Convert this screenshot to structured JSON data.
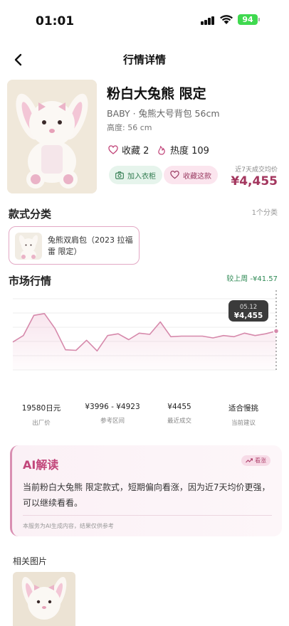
{
  "status": {
    "time": "01:01",
    "battery": "94",
    "icons": [
      "signal-icon",
      "wifi-icon",
      "battery-icon"
    ]
  },
  "nav": {
    "title": "行情详情",
    "back_icon": "chevron-left-icon"
  },
  "product": {
    "name": "粉白大兔熊 限定",
    "subtitle": "BABY · 兔熊大号背包 56cm",
    "height": "高度: 56 cm",
    "favorites": "收藏 2",
    "heat": "热度 109",
    "add_wardrobe": "加入衣柜",
    "collect": "收藏这款",
    "avg_label": "近7天成交均价",
    "avg_price": "¥4,455"
  },
  "category": {
    "title": "款式分类",
    "count": "1个分类",
    "item": "兔熊双肩包（2023 拉福雷 限定）"
  },
  "market": {
    "title": "市场行情",
    "compare": "较上周 -¥41.57",
    "tooltip_date": "05.12",
    "tooltip_price": "¥4,455"
  },
  "reference": [
    {
      "value": "19580日元",
      "label": "出厂价"
    },
    {
      "value": "¥3996 - ¥4923",
      "label": "参考区间"
    },
    {
      "value": "¥4455",
      "label": "最近成交"
    },
    {
      "value": "适合慢挑",
      "label": "当前建议"
    }
  ],
  "ai": {
    "title": "AI解读",
    "tag": "看涨",
    "text": "当前粉白大兔熊 限定款式，短期偏向看涨，因为近7天均价更强，可以继续看看。",
    "note": "本服务为AI生成内容，结果仅供参考"
  },
  "related": {
    "title": "相关图片"
  },
  "colors": {
    "accent": "#a3365e",
    "line": "#d689ab",
    "green": "#2f8a55"
  },
  "chart_data": {
    "type": "line",
    "title": "",
    "xlabel": "",
    "ylabel": "",
    "grid": true,
    "ylim": [
      3800,
      5000
    ],
    "highlight": {
      "label": "05.12",
      "value": 4455
    },
    "series": [
      {
        "values": [
          4270,
          4380,
          4720,
          4750,
          4500,
          4140,
          4130,
          4300,
          4120,
          4380,
          4410,
          4310,
          4420,
          4400,
          4610,
          4360,
          4370,
          4370,
          4370,
          4340,
          4380,
          4360,
          4420,
          4380,
          4410,
          4455
        ]
      }
    ]
  }
}
